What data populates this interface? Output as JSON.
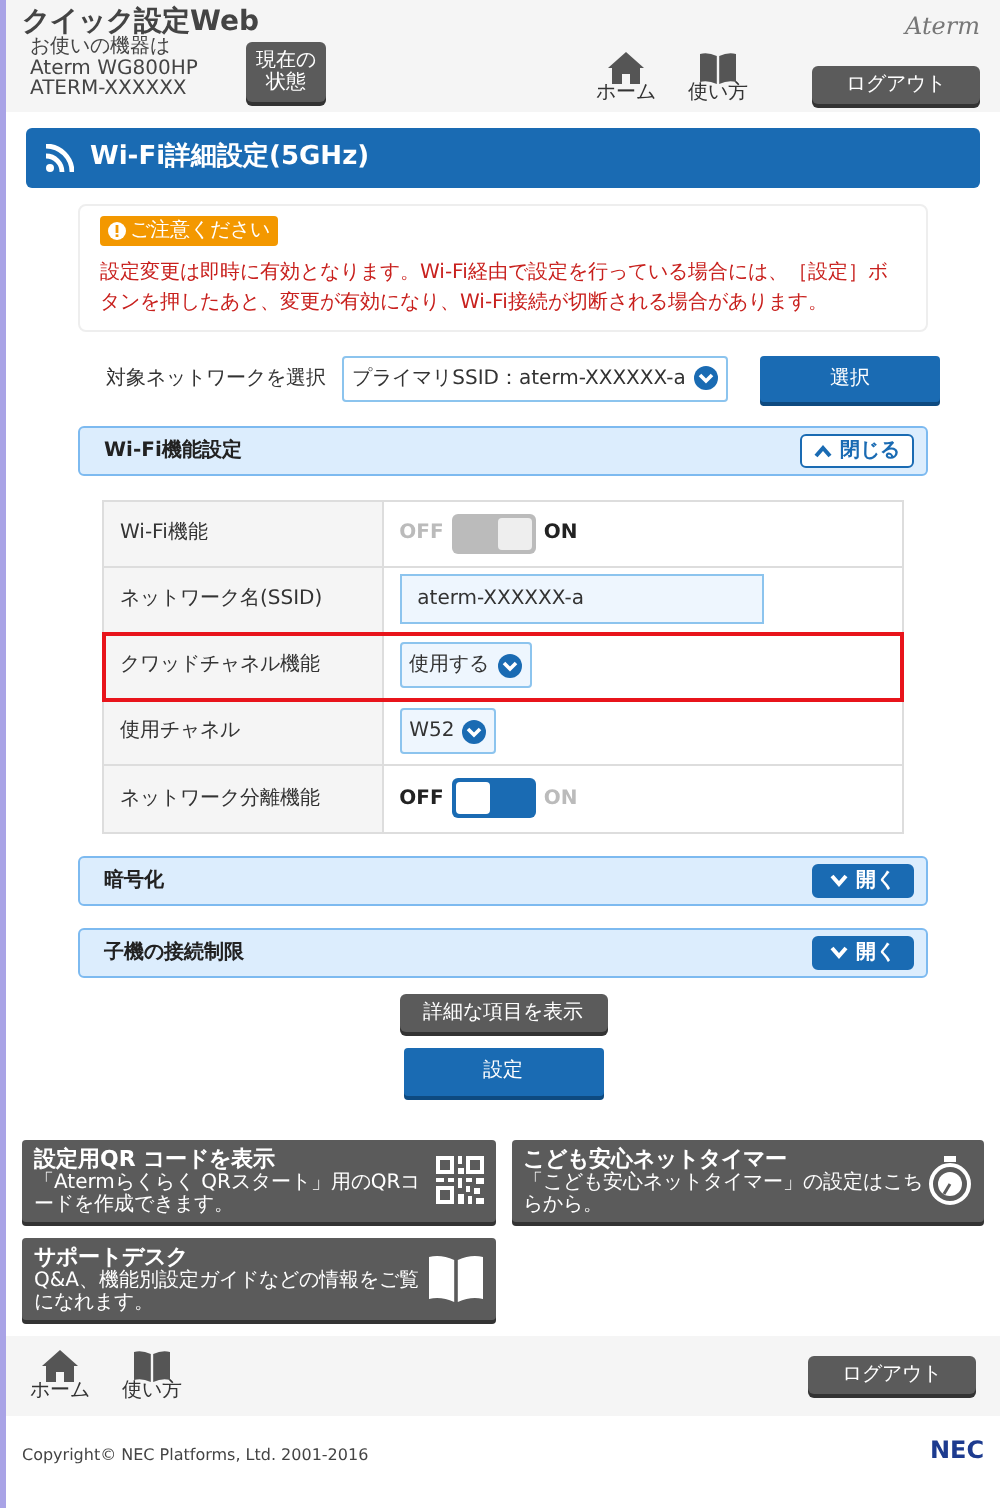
{
  "header": {
    "title": "クイック設定Web",
    "device_lines": [
      "お使いの機器は",
      "Aterm WG800HP",
      "ATERM-XXXXXX"
    ],
    "status_button": "現在の状態",
    "nav": [
      {
        "kind": "home",
        "label": "ホーム"
      },
      {
        "kind": "manual",
        "label": "使い方"
      }
    ],
    "logout": "ログアウト",
    "brand": "Aterm"
  },
  "page_title": "Wi-Fi詳細設定(5GHz)",
  "notice": {
    "badge": "ご注意ください",
    "text": "設定変更は即時に有効となります。Wi-Fi経由で設定を行っている場合には、［設定］ボタンを押したあと、変更が有効になり、Wi-Fi接続が切断される場合があります。"
  },
  "network_select": {
    "label": "対象ネットワークを選択",
    "value": "プライマリSSID：aterm-XXXXXX-a",
    "button": "選択"
  },
  "sections": [
    {
      "title": "Wi-Fi機能設定",
      "expanded": true,
      "toggle": "閉じる",
      "rows": [
        {
          "kind": "toggle",
          "label": "Wi-Fi機能",
          "off_label": "OFF",
          "on_label": "ON",
          "on": true,
          "disabled": true,
          "highlighted": false
        },
        {
          "kind": "text",
          "label": "ネットワーク名(SSID)",
          "value": "aterm-XXXXXX-a",
          "highlighted": false
        },
        {
          "kind": "select",
          "label": "クワッドチャネル機能",
          "value": "使用する",
          "highlighted": true
        },
        {
          "kind": "select",
          "label": "使用チャネル",
          "value": "W52",
          "highlighted": false
        },
        {
          "kind": "toggle",
          "label": "ネットワーク分離機能",
          "off_label": "OFF",
          "on_label": "ON",
          "on": false,
          "disabled": false,
          "highlighted": false
        }
      ]
    },
    {
      "title": "暗号化",
      "expanded": false,
      "toggle": "開く"
    },
    {
      "title": "子機の接続制限",
      "expanded": false,
      "toggle": "開く"
    }
  ],
  "details_button": "詳細な項目を表示",
  "submit_button": "設定",
  "tiles": [
    {
      "kind": "qr",
      "title": "設定用QR コードを表示",
      "subtitle": "「Atermらくらく QRスタート」用のQRコードを作成できます。"
    },
    {
      "kind": "timer",
      "title": "こども安心ネットタイマー",
      "subtitle": "「こども安心ネットタイマー」の設定はこちらから。"
    },
    {
      "kind": "book",
      "title": "サポートデスク",
      "subtitle": "Q&A、機能別設定ガイドなどの情報をご覧になれます。"
    }
  ],
  "footer": {
    "nav": [
      {
        "kind": "home",
        "label": "ホーム"
      },
      {
        "kind": "manual",
        "label": "使い方"
      }
    ],
    "logout": "ログアウト",
    "copyright": "Copyright© NEC Platforms, Ltd. 2001-2016",
    "brand": "NEC"
  }
}
